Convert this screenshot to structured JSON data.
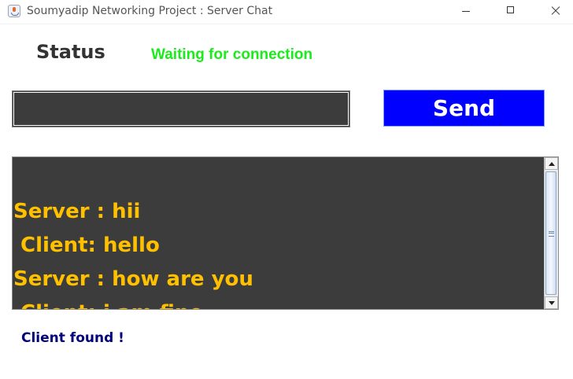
{
  "window": {
    "title": "Soumyadip Networking Project : Server Chat",
    "icon": "java-app-icon",
    "controls": [
      "minimize-icon",
      "maximize-icon",
      "close-icon"
    ]
  },
  "status": {
    "label": "Status",
    "value": "Waiting for connection",
    "value_color": "#1aeb1a"
  },
  "composer": {
    "input_value": "",
    "send_label": "Send",
    "send_color": "#0000ff"
  },
  "chat": {
    "background": "#3c3c3c",
    "text_color": "#ffc000",
    "messages": [
      "Server : hii",
      " Client: hello",
      "Server : how are you",
      " Client: i am fine"
    ]
  },
  "footer": {
    "connection_status": "Client found !"
  }
}
